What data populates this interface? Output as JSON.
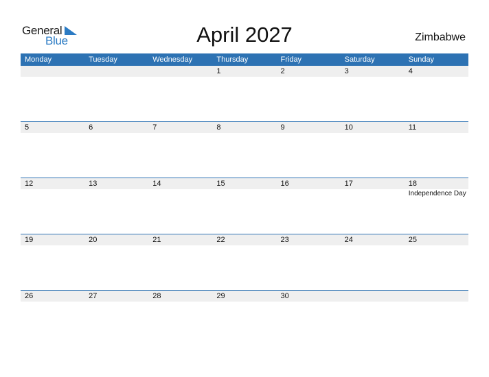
{
  "logo": {
    "word1": "General",
    "word2": "Blue",
    "accent": "#2b7bc4"
  },
  "title": "April 2027",
  "country": "Zimbabwe",
  "header_color": "#2d72b3",
  "weekdays": [
    "Monday",
    "Tuesday",
    "Wednesday",
    "Thursday",
    "Friday",
    "Saturday",
    "Sunday"
  ],
  "weeks": [
    {
      "days": [
        "",
        "",
        "",
        "1",
        "2",
        "3",
        "4"
      ],
      "events": [
        "",
        "",
        "",
        "",
        "",
        "",
        ""
      ]
    },
    {
      "days": [
        "5",
        "6",
        "7",
        "8",
        "9",
        "10",
        "11"
      ],
      "events": [
        "",
        "",
        "",
        "",
        "",
        "",
        ""
      ]
    },
    {
      "days": [
        "12",
        "13",
        "14",
        "15",
        "16",
        "17",
        "18"
      ],
      "events": [
        "",
        "",
        "",
        "",
        "",
        "",
        "Independence Day"
      ]
    },
    {
      "days": [
        "19",
        "20",
        "21",
        "22",
        "23",
        "24",
        "25"
      ],
      "events": [
        "",
        "",
        "",
        "",
        "",
        "",
        ""
      ]
    },
    {
      "days": [
        "26",
        "27",
        "28",
        "29",
        "30",
        "",
        ""
      ],
      "events": [
        "",
        "",
        "",
        "",
        "",
        "",
        ""
      ]
    }
  ]
}
